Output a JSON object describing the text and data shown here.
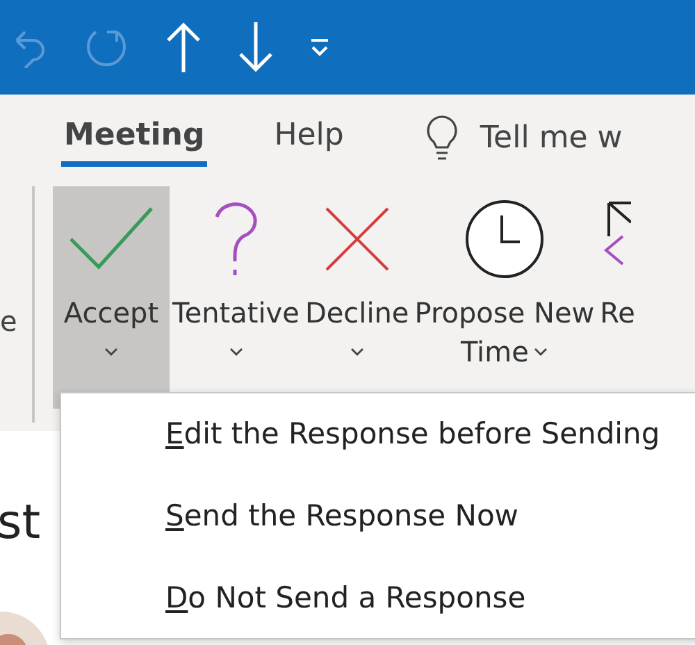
{
  "quick_access": [
    {
      "kind": "undo",
      "disabled": true
    },
    {
      "kind": "redo",
      "disabled": true
    },
    {
      "kind": "up",
      "disabled": false
    },
    {
      "kind": "down",
      "disabled": false
    },
    {
      "kind": "customize",
      "disabled": false
    }
  ],
  "tabs": [
    {
      "label": "Meeting",
      "selected": true
    },
    {
      "label": "Help",
      "selected": false
    }
  ],
  "tell_me": {
    "placeholder": "Tell me w"
  },
  "ribbon": {
    "cut_label": "e",
    "buttons": [
      {
        "kind": "accept",
        "label": "Accept",
        "selected": true
      },
      {
        "kind": "tentative",
        "label": "Tentative",
        "selected": false
      },
      {
        "kind": "decline",
        "label": "Decline",
        "selected": false
      },
      {
        "kind": "propose",
        "label": "Propose New",
        "label_2": "Time",
        "selected": false
      },
      {
        "kind": "respond",
        "label": "Re",
        "selected": false
      }
    ]
  },
  "content": {
    "title": "st"
  },
  "menu": [
    {
      "access_key": "E",
      "rest": "dit the Response before Sending"
    },
    {
      "access_key": "S",
      "rest": "end the Response Now"
    },
    {
      "access_key": "D",
      "rest": "o Not Send a Response"
    }
  ]
}
